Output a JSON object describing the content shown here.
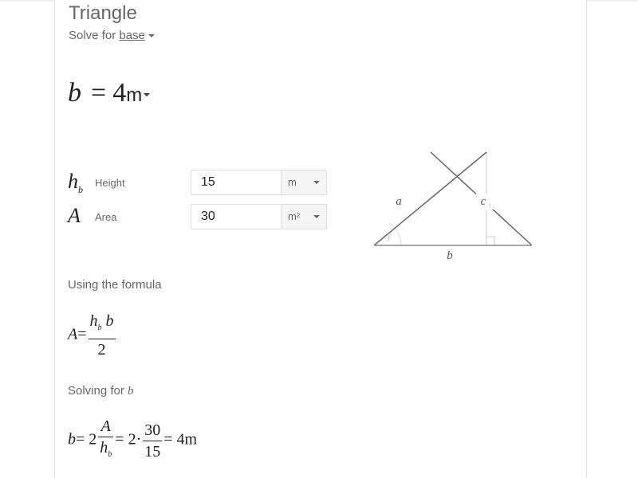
{
  "header": {
    "title": "Triangle",
    "solve_for_prefix": "Solve for",
    "solve_for_value": "base"
  },
  "result": {
    "variable": "b",
    "equals": "=",
    "value": "4",
    "unit": "m"
  },
  "inputs": [
    {
      "symbol": "h",
      "symbol_sub": "b",
      "label": "Height",
      "value": "15",
      "unit": "m"
    },
    {
      "symbol": "A",
      "symbol_sub": "",
      "label": "Area",
      "value": "30",
      "unit": "m²"
    }
  ],
  "diagram": {
    "labels": {
      "a": "a",
      "b": "b",
      "c": "c",
      "h": "h",
      "h_sub": "b",
      "gamma": "γ"
    }
  },
  "formula_section": {
    "heading": "Using the formula",
    "lhs": "A",
    "eq": "=",
    "num_h": "h",
    "num_h_sub": "b",
    "num_b": "b",
    "den": "2"
  },
  "solving_section": {
    "heading": "Solving for",
    "heading_var": "b",
    "lhs": "b",
    "eq": "=",
    "coef": "2",
    "num1": "A",
    "den1_h": "h",
    "den1_sub": "b",
    "eq2": "=",
    "coef2": "2·",
    "num2": "30",
    "den2": "15",
    "eq3": "=",
    "result": "4m"
  }
}
